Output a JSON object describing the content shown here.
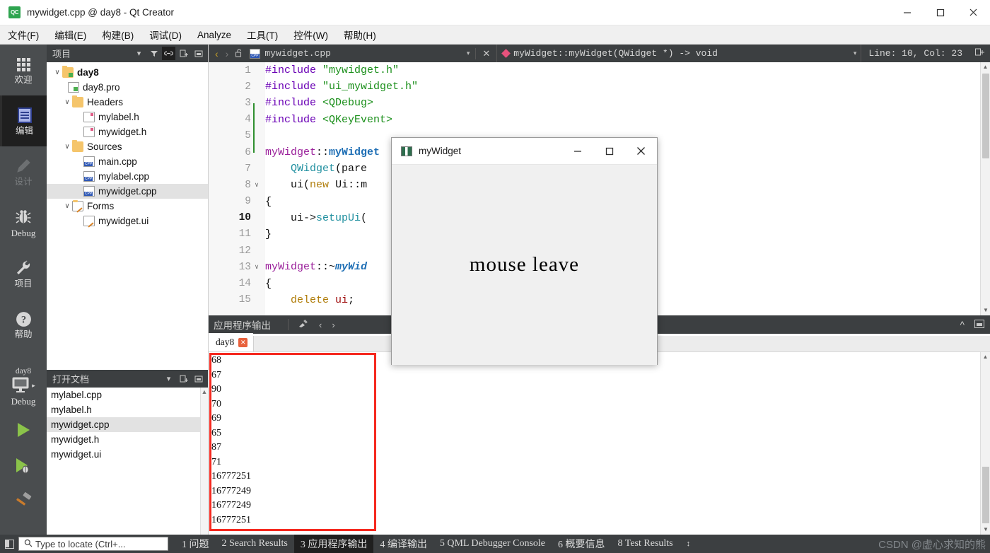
{
  "window": {
    "title": "mywidget.cpp @ day8 - Qt Creator",
    "logo_text": "QC",
    "minimize": "—",
    "maximize": "☐",
    "close": "✕"
  },
  "menubar": {
    "items": [
      {
        "label": "文件(F)",
        "mnemonic": "F"
      },
      {
        "label": "编辑(E)",
        "mnemonic": "E"
      },
      {
        "label": "构建(B)",
        "mnemonic": "B"
      },
      {
        "label": "调试(D)",
        "mnemonic": "D"
      },
      {
        "label": "Analyze",
        "mnemonic": "A"
      },
      {
        "label": "工具(T)",
        "mnemonic": "T"
      },
      {
        "label": "控件(W)",
        "mnemonic": "W"
      },
      {
        "label": "帮助(H)",
        "mnemonic": "H"
      }
    ]
  },
  "activitybar": {
    "items": [
      {
        "label": "欢迎",
        "icon": "grid-icon",
        "active": false,
        "disabled": false
      },
      {
        "label": "编辑",
        "icon": "document-icon",
        "active": true,
        "disabled": false
      },
      {
        "label": "设计",
        "icon": "pencil-icon",
        "active": false,
        "disabled": true
      },
      {
        "label": "Debug",
        "icon": "bug-icon",
        "active": false,
        "disabled": false
      },
      {
        "label": "项目",
        "icon": "wrench-icon",
        "active": false,
        "disabled": false
      },
      {
        "label": "帮助",
        "icon": "question-icon",
        "active": false,
        "disabled": false
      }
    ],
    "kit": {
      "project": "day8",
      "mode": "Debug",
      "icon": "monitor-icon",
      "arrow": "▸"
    },
    "run_buttons": [
      {
        "name": "run-button",
        "icon": "play-icon"
      },
      {
        "name": "debug-button",
        "icon": "play-bug-icon"
      },
      {
        "name": "build-button",
        "icon": "hammer-icon"
      }
    ]
  },
  "project_panel": {
    "title": "项目",
    "tools": [
      "chevron-down-icon",
      "filter-icon",
      "link-icon",
      "add-icon",
      "minimize-panel-icon"
    ],
    "tree": [
      {
        "label": "day8",
        "indent": 0,
        "chev": "∨",
        "icon": "project-folder",
        "bold": true,
        "selected": false
      },
      {
        "label": "day8.pro",
        "indent": 1,
        "chev": "",
        "icon": "pro-file",
        "bold": false,
        "selected": false
      },
      {
        "label": "Headers",
        "indent": 1,
        "chev": "∨",
        "icon": "headers-folder",
        "bold": false,
        "selected": false
      },
      {
        "label": "mylabel.h",
        "indent": 2,
        "chev": "",
        "icon": "h-file",
        "bold": false,
        "selected": false
      },
      {
        "label": "mywidget.h",
        "indent": 2,
        "chev": "",
        "icon": "h-file",
        "bold": false,
        "selected": false
      },
      {
        "label": "Sources",
        "indent": 1,
        "chev": "∨",
        "icon": "sources-folder",
        "bold": false,
        "selected": false
      },
      {
        "label": "main.cpp",
        "indent": 2,
        "chev": "",
        "icon": "cpp-file",
        "bold": false,
        "selected": false
      },
      {
        "label": "mylabel.cpp",
        "indent": 2,
        "chev": "",
        "icon": "cpp-file",
        "bold": false,
        "selected": false
      },
      {
        "label": "mywidget.cpp",
        "indent": 2,
        "chev": "",
        "icon": "cpp-file",
        "bold": false,
        "selected": true
      },
      {
        "label": "Forms",
        "indent": 1,
        "chev": "∨",
        "icon": "forms-folder",
        "bold": false,
        "selected": false
      },
      {
        "label": "mywidget.ui",
        "indent": 2,
        "chev": "",
        "icon": "ui-file",
        "bold": false,
        "selected": false
      }
    ]
  },
  "open_documents": {
    "title": "打开文档",
    "tools": [
      "chevron-down-icon",
      "add-icon",
      "minimize-panel-icon"
    ],
    "items": [
      {
        "label": "mylabel.cpp",
        "selected": false
      },
      {
        "label": "mylabel.h",
        "selected": false
      },
      {
        "label": "mywidget.cpp",
        "selected": true
      },
      {
        "label": "mywidget.h",
        "selected": false
      },
      {
        "label": "mywidget.ui",
        "selected": false
      }
    ]
  },
  "editor_toolbar": {
    "back": "‹",
    "forward": "›",
    "lock_icon": "unlocked-icon",
    "filename": "mywidget.cpp",
    "file_icon": "cpp-file-icon",
    "dropdown": "▾",
    "close": "✕",
    "symbol": "myWidget::myWidget(QWidget *) -> void",
    "symbol_icon": "pink-diamond-icon",
    "symbol_dropdown": "▾",
    "line_col": "Line: 10, Col: 23",
    "split_icon": "split-editor-icon"
  },
  "code": {
    "lines": [
      {
        "n": 1,
        "fold": "",
        "current": false,
        "mark": true,
        "tokens": [
          {
            "t": "#include ",
            "c": "k-pre"
          },
          {
            "t": "\"mywidget.h\"",
            "c": "k-str"
          }
        ]
      },
      {
        "n": 2,
        "fold": "",
        "current": false,
        "mark": true,
        "tokens": [
          {
            "t": "#include ",
            "c": "k-pre"
          },
          {
            "t": "\"ui_mywidget.h\"",
            "c": "k-str"
          }
        ]
      },
      {
        "n": 3,
        "fold": "",
        "current": false,
        "mark": true,
        "tokens": [
          {
            "t": "#include ",
            "c": "k-pre"
          },
          {
            "t": "<QDebug>",
            "c": "k-ang"
          }
        ]
      },
      {
        "n": 4,
        "fold": "",
        "current": false,
        "mark": true,
        "tokens": [
          {
            "t": "#include ",
            "c": "k-pre"
          },
          {
            "t": "<QKeyEvent>",
            "c": "k-ang"
          }
        ]
      },
      {
        "n": 5,
        "fold": "",
        "current": false,
        "mark": false,
        "tokens": []
      },
      {
        "n": 6,
        "fold": "",
        "current": false,
        "mark": false,
        "tokens": [
          {
            "t": "myWidget",
            "c": "k-type"
          },
          {
            "t": "::",
            "c": "k-plain"
          },
          {
            "t": "myWidget",
            "c": "k-fnname"
          }
        ]
      },
      {
        "n": 7,
        "fold": "",
        "current": false,
        "mark": false,
        "tokens": [
          {
            "t": "    ",
            "c": "k-plain"
          },
          {
            "t": "QWidget",
            "c": "k-call"
          },
          {
            "t": "(pare",
            "c": "k-plain"
          }
        ]
      },
      {
        "n": 8,
        "fold": "∨",
        "current": false,
        "mark": false,
        "tokens": [
          {
            "t": "    ",
            "c": "k-plain"
          },
          {
            "t": "ui",
            "c": "k-plain"
          },
          {
            "t": "(",
            "c": "k-plain"
          },
          {
            "t": "new",
            "c": "k-kw"
          },
          {
            "t": " Ui::m",
            "c": "k-plain"
          }
        ]
      },
      {
        "n": 9,
        "fold": "",
        "current": false,
        "mark": false,
        "tokens": [
          {
            "t": "{",
            "c": "k-plain"
          }
        ]
      },
      {
        "n": 10,
        "fold": "",
        "current": true,
        "mark": false,
        "tokens": [
          {
            "t": "    ui->",
            "c": "k-plain"
          },
          {
            "t": "setupUi",
            "c": "k-call"
          },
          {
            "t": "(",
            "c": "k-plain"
          }
        ]
      },
      {
        "n": 11,
        "fold": "",
        "current": false,
        "mark": false,
        "tokens": [
          {
            "t": "}",
            "c": "k-plain"
          }
        ]
      },
      {
        "n": 12,
        "fold": "",
        "current": false,
        "mark": false,
        "tokens": []
      },
      {
        "n": 13,
        "fold": "∨",
        "current": false,
        "mark": false,
        "tokens": [
          {
            "t": "myWidget",
            "c": "k-type"
          },
          {
            "t": "::~",
            "c": "k-plain"
          },
          {
            "t": "myWid",
            "c": "k-fn-it"
          }
        ]
      },
      {
        "n": 14,
        "fold": "",
        "current": false,
        "mark": false,
        "tokens": [
          {
            "t": "{",
            "c": "k-plain"
          }
        ]
      },
      {
        "n": 15,
        "fold": "",
        "current": false,
        "mark": false,
        "tokens": [
          {
            "t": "    ",
            "c": "k-plain"
          },
          {
            "t": "delete",
            "c": "k-kw"
          },
          {
            "t": " ",
            "c": "k-plain"
          },
          {
            "t": "ui",
            "c": "k-mem"
          },
          {
            "t": ";",
            "c": "k-plain"
          }
        ]
      }
    ]
  },
  "output_pane": {
    "title": "应用程序输出",
    "tools": [
      "clear-output-icon",
      "prev-item-icon",
      "next-item-icon"
    ],
    "right_tools": [
      "collapse-icon",
      "maximize-output-icon"
    ],
    "tab": {
      "label": "day8",
      "close": "✕"
    },
    "lines": [
      "68",
      "67",
      "90",
      "70",
      "69",
      "65",
      "87",
      "71",
      "16777251",
      "16777249",
      "16777249",
      "16777251"
    ],
    "highlight_color": "#f5291f"
  },
  "mywidget_window": {
    "title": "myWidget",
    "icon": "app-icon",
    "minimize": "—",
    "maximize": "☐",
    "close": "✕",
    "content_text": "mouse leave"
  },
  "statusbar": {
    "sidebar_toggle_icon": "toggle-sidebar-icon",
    "locate_icon": "search-icon",
    "locate_placeholder": "Type to locate (Ctrl+...",
    "items": [
      {
        "num": "1",
        "label": "问题",
        "active": false
      },
      {
        "num": "2",
        "label": "Search Results",
        "active": false
      },
      {
        "num": "3",
        "label": "应用程序输出",
        "active": true
      },
      {
        "num": "4",
        "label": "编译输出",
        "active": false
      },
      {
        "num": "5",
        "label": "QML Debugger Console",
        "active": false
      },
      {
        "num": "6",
        "label": "概要信息",
        "active": false
      },
      {
        "num": "8",
        "label": "Test Results",
        "active": false
      }
    ],
    "updown": "↕",
    "watermark": "CSDN @虚心求知的熊"
  }
}
